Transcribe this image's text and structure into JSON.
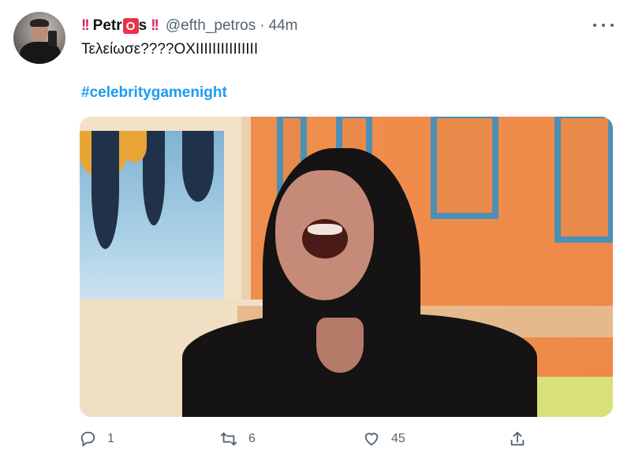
{
  "tweet": {
    "display_name_parts": [
      "!!",
      "Petr",
      "O",
      "s",
      "!!"
    ],
    "handle": "@efth_petros",
    "separator": "·",
    "time": "44m",
    "text": "Τελείωσε????ΟΧΙΙΙΙΙΙΙΙΙΙΙΙΙΙΙ",
    "hashtag": "#celebritygamenight"
  },
  "actions": {
    "replies": "1",
    "retweets": "6",
    "likes": "45"
  },
  "icons": {
    "reply": "reply-icon",
    "retweet": "retweet-icon",
    "like": "heart-icon",
    "share": "share-icon",
    "more": "more-icon"
  },
  "colors": {
    "link": "#1d9bf0",
    "secondary_text": "#536471",
    "name_accent": "#e0245e"
  }
}
